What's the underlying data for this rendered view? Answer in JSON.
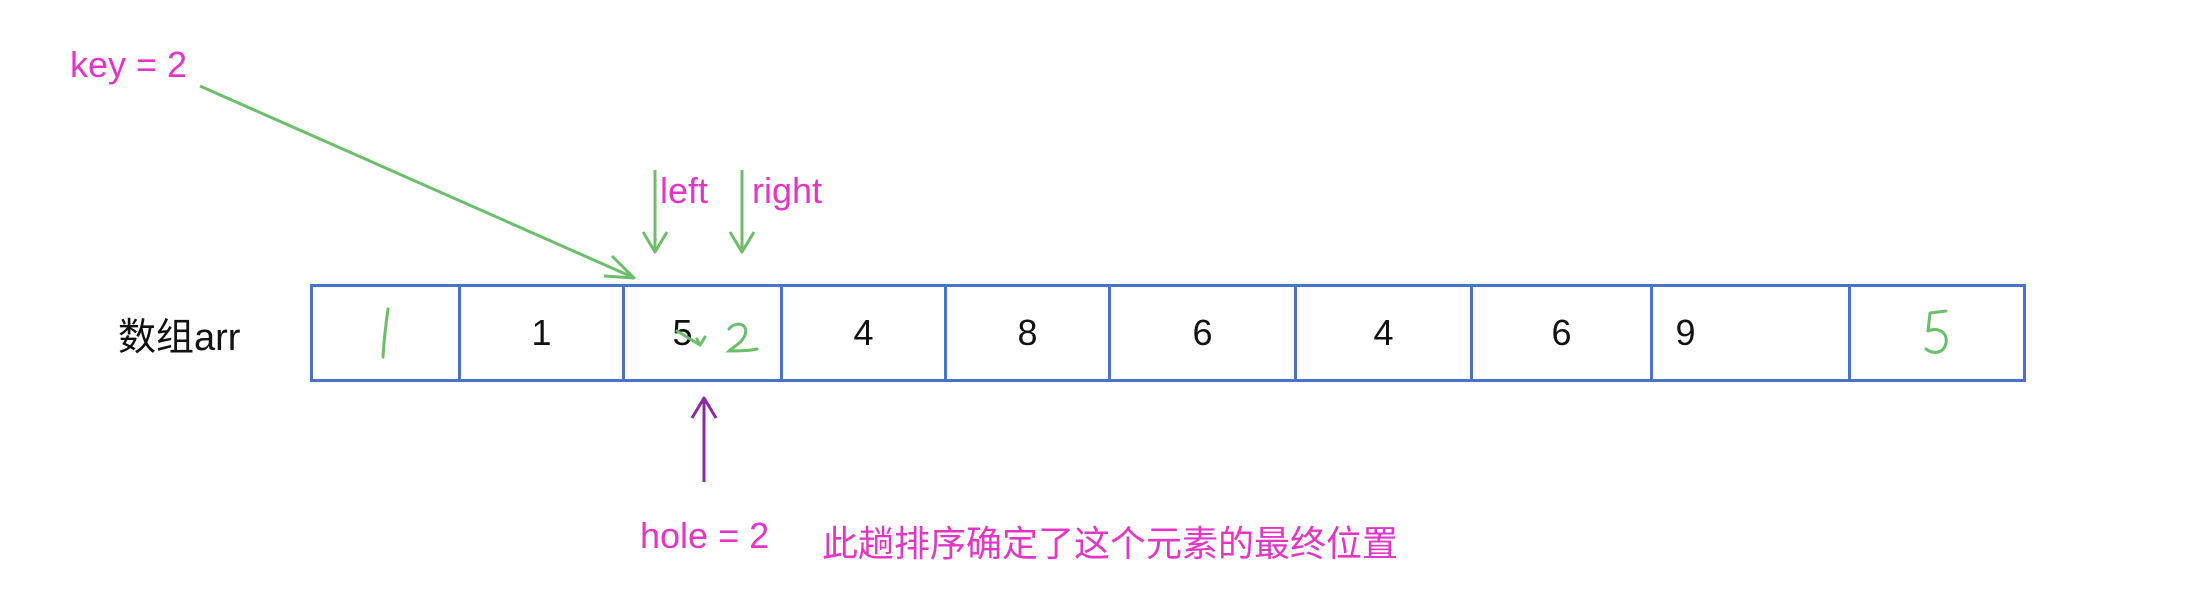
{
  "key_label": "key = 2",
  "pointers": {
    "left": "left",
    "right": "right"
  },
  "array_name": "数组arr",
  "cells": [
    "1",
    "1",
    "5",
    "4",
    "8",
    "6",
    "4",
    "6",
    "9",
    "5"
  ],
  "handwritten": {
    "cell3_new": "2"
  },
  "hole_label": "hole = 2",
  "note": "此趟排序确定了这个元素的最终位置",
  "colors": {
    "annotation": "#e535c7",
    "arrow_green": "#6cbf6a",
    "border_blue": "#4a72c9",
    "hole_arrow": "#8a2aa6"
  }
}
